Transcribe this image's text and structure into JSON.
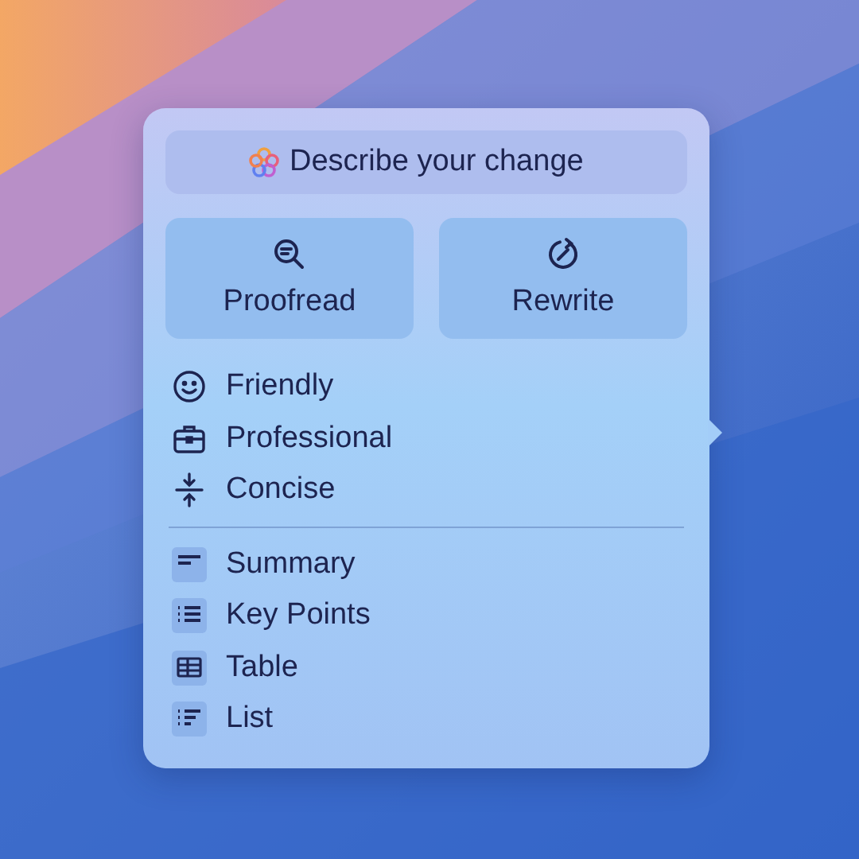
{
  "prompt": {
    "placeholder": "Describe your change"
  },
  "actions": [
    {
      "label": "Proofread",
      "kind": "proofread"
    },
    {
      "label": "Rewrite",
      "kind": "rewrite"
    }
  ],
  "tones": [
    {
      "label": "Friendly",
      "kind": "friendly"
    },
    {
      "label": "Professional",
      "kind": "professional"
    },
    {
      "label": "Concise",
      "kind": "concise"
    }
  ],
  "formats": [
    {
      "label": "Summary",
      "kind": "summary"
    },
    {
      "label": "Key Points",
      "kind": "keypoints"
    },
    {
      "label": "Table",
      "kind": "table"
    },
    {
      "label": "List",
      "kind": "list"
    }
  ]
}
